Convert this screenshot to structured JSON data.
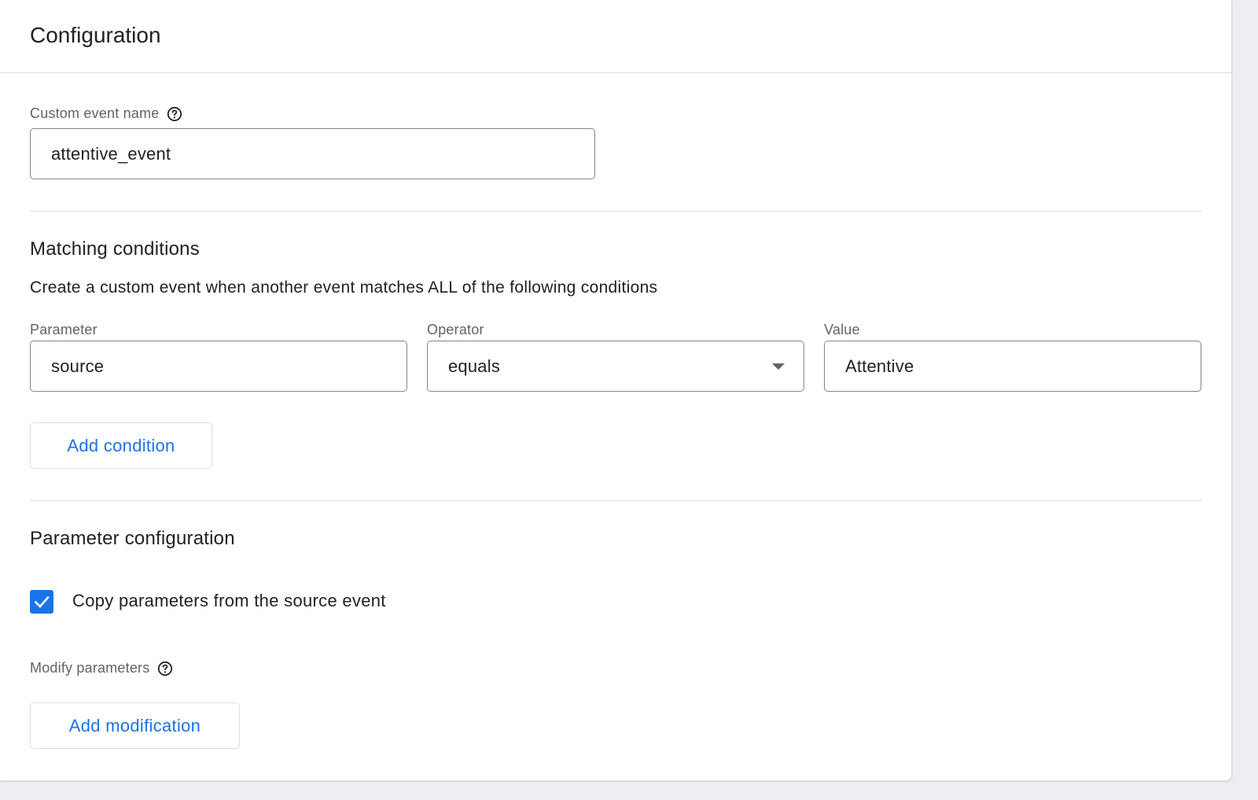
{
  "header": {
    "title": "Configuration"
  },
  "custom_event": {
    "label": "Custom event name",
    "help_icon": "help-circle-icon",
    "value": "attentive_event"
  },
  "matching": {
    "title": "Matching conditions",
    "description": "Create a custom event when another event matches ALL of the following conditions",
    "columns": {
      "parameter_label": "Parameter",
      "operator_label": "Operator",
      "value_label": "Value"
    },
    "condition": {
      "parameter": "source",
      "operator": "equals",
      "value": "Attentive"
    },
    "add_condition_label": "Add condition"
  },
  "parameter_config": {
    "title": "Parameter configuration",
    "copy_checkbox": {
      "checked": true,
      "label": "Copy parameters from the source event"
    },
    "modify_label": "Modify parameters",
    "help_icon": "help-circle-icon",
    "add_modification_label": "Add modification"
  },
  "colors": {
    "accent": "#1a73e8",
    "text": "#202124",
    "secondary_text": "#5f6368",
    "border": "#dadce0"
  }
}
